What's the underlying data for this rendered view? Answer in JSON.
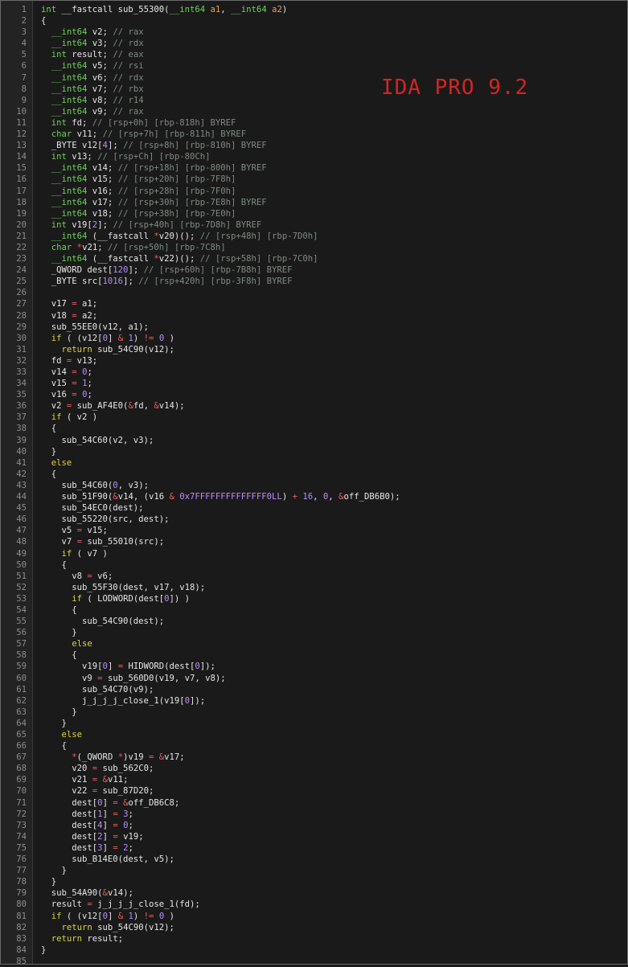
{
  "watermark": "IDA PRO 9.2",
  "lines": [
    [
      [
        "t",
        "int"
      ],
      [
        "p",
        " __fastcall sub_55300("
      ],
      [
        "t",
        "__int64"
      ],
      [
        "p",
        " "
      ],
      [
        "a",
        "a1"
      ],
      [
        "p",
        ", "
      ],
      [
        "t",
        "__int64"
      ],
      [
        "p",
        " "
      ],
      [
        "a",
        "a2"
      ],
      [
        "p",
        ")"
      ]
    ],
    [
      [
        "p",
        "{"
      ]
    ],
    [
      [
        "p",
        "  "
      ],
      [
        "t",
        "__int64"
      ],
      [
        "p",
        " v2; "
      ],
      [
        "c",
        "// rax"
      ]
    ],
    [
      [
        "p",
        "  "
      ],
      [
        "t",
        "__int64"
      ],
      [
        "p",
        " v3; "
      ],
      [
        "c",
        "// rdx"
      ]
    ],
    [
      [
        "p",
        "  "
      ],
      [
        "t",
        "int"
      ],
      [
        "p",
        " result; "
      ],
      [
        "c",
        "// eax"
      ]
    ],
    [
      [
        "p",
        "  "
      ],
      [
        "t",
        "__int64"
      ],
      [
        "p",
        " v5; "
      ],
      [
        "c",
        "// rsi"
      ]
    ],
    [
      [
        "p",
        "  "
      ],
      [
        "t",
        "__int64"
      ],
      [
        "p",
        " v6; "
      ],
      [
        "c",
        "// rdx"
      ]
    ],
    [
      [
        "p",
        "  "
      ],
      [
        "t",
        "__int64"
      ],
      [
        "p",
        " v7; "
      ],
      [
        "c",
        "// rbx"
      ]
    ],
    [
      [
        "p",
        "  "
      ],
      [
        "t",
        "__int64"
      ],
      [
        "p",
        " v8; "
      ],
      [
        "c",
        "// r14"
      ]
    ],
    [
      [
        "p",
        "  "
      ],
      [
        "t",
        "__int64"
      ],
      [
        "p",
        " v9; "
      ],
      [
        "c",
        "// rax"
      ]
    ],
    [
      [
        "p",
        "  "
      ],
      [
        "t",
        "int"
      ],
      [
        "p",
        " fd; "
      ],
      [
        "c",
        "// [rsp+0h] [rbp-818h] BYREF"
      ]
    ],
    [
      [
        "p",
        "  "
      ],
      [
        "t",
        "char"
      ],
      [
        "p",
        " v11; "
      ],
      [
        "c",
        "// [rsp+7h] [rbp-811h] BYREF"
      ]
    ],
    [
      [
        "p",
        "  _BYTE v12["
      ],
      [
        "n",
        "4"
      ],
      [
        "p",
        "]; "
      ],
      [
        "c",
        "// [rsp+8h] [rbp-810h] BYREF"
      ]
    ],
    [
      [
        "p",
        "  "
      ],
      [
        "t",
        "int"
      ],
      [
        "p",
        " v13; "
      ],
      [
        "c",
        "// [rsp+Ch] [rbp-80Ch]"
      ]
    ],
    [
      [
        "p",
        "  "
      ],
      [
        "t",
        "__int64"
      ],
      [
        "p",
        " v14; "
      ],
      [
        "c",
        "// [rsp+18h] [rbp-800h] BYREF"
      ]
    ],
    [
      [
        "p",
        "  "
      ],
      [
        "t",
        "__int64"
      ],
      [
        "p",
        " v15; "
      ],
      [
        "c",
        "// [rsp+20h] [rbp-7F8h]"
      ]
    ],
    [
      [
        "p",
        "  "
      ],
      [
        "t",
        "__int64"
      ],
      [
        "p",
        " v16; "
      ],
      [
        "c",
        "// [rsp+28h] [rbp-7F0h]"
      ]
    ],
    [
      [
        "p",
        "  "
      ],
      [
        "t",
        "__int64"
      ],
      [
        "p",
        " v17; "
      ],
      [
        "c",
        "// [rsp+30h] [rbp-7E8h] BYREF"
      ]
    ],
    [
      [
        "p",
        "  "
      ],
      [
        "t",
        "__int64"
      ],
      [
        "p",
        " v18; "
      ],
      [
        "c",
        "// [rsp+38h] [rbp-7E0h]"
      ]
    ],
    [
      [
        "p",
        "  "
      ],
      [
        "t",
        "int"
      ],
      [
        "p",
        " v19["
      ],
      [
        "n",
        "2"
      ],
      [
        "p",
        "]; "
      ],
      [
        "c",
        "// [rsp+40h] [rbp-7D8h] BYREF"
      ]
    ],
    [
      [
        "p",
        "  "
      ],
      [
        "t",
        "__int64"
      ],
      [
        "p",
        " (__fastcall "
      ],
      [
        "o",
        "*"
      ],
      [
        "p",
        "v20)(); "
      ],
      [
        "c",
        "// [rsp+48h] [rbp-7D0h]"
      ]
    ],
    [
      [
        "p",
        "  "
      ],
      [
        "t",
        "char"
      ],
      [
        "p",
        " "
      ],
      [
        "o",
        "*"
      ],
      [
        "p",
        "v21; "
      ],
      [
        "c",
        "// [rsp+50h] [rbp-7C8h]"
      ]
    ],
    [
      [
        "p",
        "  "
      ],
      [
        "t",
        "__int64"
      ],
      [
        "p",
        " (__fastcall "
      ],
      [
        "o",
        "*"
      ],
      [
        "p",
        "v22)(); "
      ],
      [
        "c",
        "// [rsp+58h] [rbp-7C0h]"
      ]
    ],
    [
      [
        "p",
        "  _QWORD dest["
      ],
      [
        "n",
        "120"
      ],
      [
        "p",
        "]; "
      ],
      [
        "c",
        "// [rsp+60h] [rbp-7B8h] BYREF"
      ]
    ],
    [
      [
        "p",
        "  _BYTE src["
      ],
      [
        "n",
        "1016"
      ],
      [
        "p",
        "]; "
      ],
      [
        "c",
        "// [rsp+420h] [rbp-3F8h] BYREF"
      ]
    ],
    [],
    [
      [
        "p",
        "  v17 "
      ],
      [
        "o",
        "="
      ],
      [
        "p",
        " a1;"
      ]
    ],
    [
      [
        "p",
        "  v18 "
      ],
      [
        "o",
        "="
      ],
      [
        "p",
        " a2;"
      ]
    ],
    [
      [
        "p",
        "  sub_55EE0(v12, a1);"
      ]
    ],
    [
      [
        "p",
        "  "
      ],
      [
        "k",
        "if"
      ],
      [
        "p",
        " ( (v12["
      ],
      [
        "n",
        "0"
      ],
      [
        "p",
        "] "
      ],
      [
        "o",
        "&"
      ],
      [
        "p",
        " "
      ],
      [
        "n",
        "1"
      ],
      [
        "p",
        ") "
      ],
      [
        "o",
        "!="
      ],
      [
        "p",
        " "
      ],
      [
        "n",
        "0"
      ],
      [
        "p",
        " )"
      ]
    ],
    [
      [
        "p",
        "    "
      ],
      [
        "k",
        "return"
      ],
      [
        "p",
        " sub_54C90(v12);"
      ]
    ],
    [
      [
        "p",
        "  fd "
      ],
      [
        "o",
        "="
      ],
      [
        "p",
        " v13;"
      ]
    ],
    [
      [
        "p",
        "  v14 "
      ],
      [
        "o",
        "="
      ],
      [
        "p",
        " "
      ],
      [
        "n",
        "0"
      ],
      [
        "p",
        ";"
      ]
    ],
    [
      [
        "p",
        "  v15 "
      ],
      [
        "o",
        "="
      ],
      [
        "p",
        " "
      ],
      [
        "n",
        "1"
      ],
      [
        "p",
        ";"
      ]
    ],
    [
      [
        "p",
        "  v16 "
      ],
      [
        "o",
        "="
      ],
      [
        "p",
        " "
      ],
      [
        "n",
        "0"
      ],
      [
        "p",
        ";"
      ]
    ],
    [
      [
        "p",
        "  v2 "
      ],
      [
        "o",
        "="
      ],
      [
        "p",
        " sub_AF4E0("
      ],
      [
        "o",
        "&"
      ],
      [
        "p",
        "fd, "
      ],
      [
        "o",
        "&"
      ],
      [
        "p",
        "v14);"
      ]
    ],
    [
      [
        "p",
        "  "
      ],
      [
        "k",
        "if"
      ],
      [
        "p",
        " ( v2 )"
      ]
    ],
    [
      [
        "p",
        "  {"
      ]
    ],
    [
      [
        "p",
        "    sub_54C60(v2, v3);"
      ]
    ],
    [
      [
        "p",
        "  }"
      ]
    ],
    [
      [
        "p",
        "  "
      ],
      [
        "k",
        "else"
      ]
    ],
    [
      [
        "p",
        "  {"
      ]
    ],
    [
      [
        "p",
        "    sub_54C60("
      ],
      [
        "n",
        "0"
      ],
      [
        "p",
        ", v3);"
      ]
    ],
    [
      [
        "p",
        "    sub_51F90("
      ],
      [
        "o",
        "&"
      ],
      [
        "p",
        "v14, (v16 "
      ],
      [
        "o",
        "&"
      ],
      [
        "p",
        " "
      ],
      [
        "n",
        "0x7FFFFFFFFFFFFFF0LL"
      ],
      [
        "p",
        ") "
      ],
      [
        "o",
        "+"
      ],
      [
        "p",
        " "
      ],
      [
        "n",
        "16"
      ],
      [
        "p",
        ", "
      ],
      [
        "n",
        "0"
      ],
      [
        "p",
        ", "
      ],
      [
        "o",
        "&"
      ],
      [
        "p",
        "off_DB6B0);"
      ]
    ],
    [
      [
        "p",
        "    sub_54EC0(dest);"
      ]
    ],
    [
      [
        "p",
        "    sub_55220(src, dest);"
      ]
    ],
    [
      [
        "p",
        "    v5 "
      ],
      [
        "o",
        "="
      ],
      [
        "p",
        " v15;"
      ]
    ],
    [
      [
        "p",
        "    v7 "
      ],
      [
        "o",
        "="
      ],
      [
        "p",
        " sub_55010(src);"
      ]
    ],
    [
      [
        "p",
        "    "
      ],
      [
        "k",
        "if"
      ],
      [
        "p",
        " ( v7 )"
      ]
    ],
    [
      [
        "p",
        "    {"
      ]
    ],
    [
      [
        "p",
        "      v8 "
      ],
      [
        "o",
        "="
      ],
      [
        "p",
        " v6;"
      ]
    ],
    [
      [
        "p",
        "      sub_55F30(dest, v17, v18);"
      ]
    ],
    [
      [
        "p",
        "      "
      ],
      [
        "k",
        "if"
      ],
      [
        "p",
        " ( LODWORD(dest["
      ],
      [
        "n",
        "0"
      ],
      [
        "p",
        "]) )"
      ]
    ],
    [
      [
        "p",
        "      {"
      ]
    ],
    [
      [
        "p",
        "        sub_54C90(dest);"
      ]
    ],
    [
      [
        "p",
        "      }"
      ]
    ],
    [
      [
        "p",
        "      "
      ],
      [
        "k",
        "else"
      ]
    ],
    [
      [
        "p",
        "      {"
      ]
    ],
    [
      [
        "p",
        "        v19["
      ],
      [
        "n",
        "0"
      ],
      [
        "p",
        "] "
      ],
      [
        "o",
        "="
      ],
      [
        "p",
        " HIDWORD(dest["
      ],
      [
        "n",
        "0"
      ],
      [
        "p",
        "]);"
      ]
    ],
    [
      [
        "p",
        "        v9 "
      ],
      [
        "o",
        "="
      ],
      [
        "p",
        " sub_560D0(v19, v7, v8);"
      ]
    ],
    [
      [
        "p",
        "        sub_54C70(v9);"
      ]
    ],
    [
      [
        "p",
        "        j_j_j_j_close_1(v19["
      ],
      [
        "n",
        "0"
      ],
      [
        "p",
        "]);"
      ]
    ],
    [
      [
        "p",
        "      }"
      ]
    ],
    [
      [
        "p",
        "    }"
      ]
    ],
    [
      [
        "p",
        "    "
      ],
      [
        "k",
        "else"
      ]
    ],
    [
      [
        "p",
        "    {"
      ]
    ],
    [
      [
        "p",
        "      "
      ],
      [
        "o",
        "*"
      ],
      [
        "p",
        "(_QWORD "
      ],
      [
        "o",
        "*"
      ],
      [
        "p",
        ")v19 "
      ],
      [
        "o",
        "="
      ],
      [
        "p",
        " "
      ],
      [
        "o",
        "&"
      ],
      [
        "p",
        "v17;"
      ]
    ],
    [
      [
        "p",
        "      v20 "
      ],
      [
        "o",
        "="
      ],
      [
        "p",
        " sub_562C0;"
      ]
    ],
    [
      [
        "p",
        "      v21 "
      ],
      [
        "o",
        "="
      ],
      [
        "p",
        " "
      ],
      [
        "o",
        "&"
      ],
      [
        "p",
        "v11;"
      ]
    ],
    [
      [
        "p",
        "      v22 "
      ],
      [
        "o",
        "="
      ],
      [
        "p",
        " sub_87D20;"
      ]
    ],
    [
      [
        "p",
        "      dest["
      ],
      [
        "n",
        "0"
      ],
      [
        "p",
        "] "
      ],
      [
        "o",
        "="
      ],
      [
        "p",
        " "
      ],
      [
        "o",
        "&"
      ],
      [
        "p",
        "off_DB6C8;"
      ]
    ],
    [
      [
        "p",
        "      dest["
      ],
      [
        "n",
        "1"
      ],
      [
        "p",
        "] "
      ],
      [
        "o",
        "="
      ],
      [
        "p",
        " "
      ],
      [
        "n",
        "3"
      ],
      [
        "p",
        ";"
      ]
    ],
    [
      [
        "p",
        "      dest["
      ],
      [
        "n",
        "4"
      ],
      [
        "p",
        "] "
      ],
      [
        "o",
        "="
      ],
      [
        "p",
        " "
      ],
      [
        "n",
        "0"
      ],
      [
        "p",
        ";"
      ]
    ],
    [
      [
        "p",
        "      dest["
      ],
      [
        "n",
        "2"
      ],
      [
        "p",
        "] "
      ],
      [
        "o",
        "="
      ],
      [
        "p",
        " v19;"
      ]
    ],
    [
      [
        "p",
        "      dest["
      ],
      [
        "n",
        "3"
      ],
      [
        "p",
        "] "
      ],
      [
        "o",
        "="
      ],
      [
        "p",
        " "
      ],
      [
        "n",
        "2"
      ],
      [
        "p",
        ";"
      ]
    ],
    [
      [
        "p",
        "      sub_B14E0(dest, v5);"
      ]
    ],
    [
      [
        "p",
        "    }"
      ]
    ],
    [
      [
        "p",
        "  }"
      ]
    ],
    [
      [
        "p",
        "  sub_54A90("
      ],
      [
        "o",
        "&"
      ],
      [
        "p",
        "v14);"
      ]
    ],
    [
      [
        "p",
        "  result "
      ],
      [
        "o",
        "="
      ],
      [
        "p",
        " j_j_j_j_close_1(fd);"
      ]
    ],
    [
      [
        "p",
        "  "
      ],
      [
        "k",
        "if"
      ],
      [
        "p",
        " ( (v12["
      ],
      [
        "n",
        "0"
      ],
      [
        "p",
        "] "
      ],
      [
        "o",
        "&"
      ],
      [
        "p",
        " "
      ],
      [
        "n",
        "1"
      ],
      [
        "p",
        ") "
      ],
      [
        "o",
        "!="
      ],
      [
        "p",
        " "
      ],
      [
        "n",
        "0"
      ],
      [
        "p",
        " )"
      ]
    ],
    [
      [
        "p",
        "    "
      ],
      [
        "k",
        "return"
      ],
      [
        "p",
        " sub_54C90(v12);"
      ]
    ],
    [
      [
        "p",
        "  "
      ],
      [
        "k",
        "return"
      ],
      [
        "p",
        " result;"
      ]
    ],
    [
      [
        "p",
        "}"
      ]
    ],
    []
  ]
}
